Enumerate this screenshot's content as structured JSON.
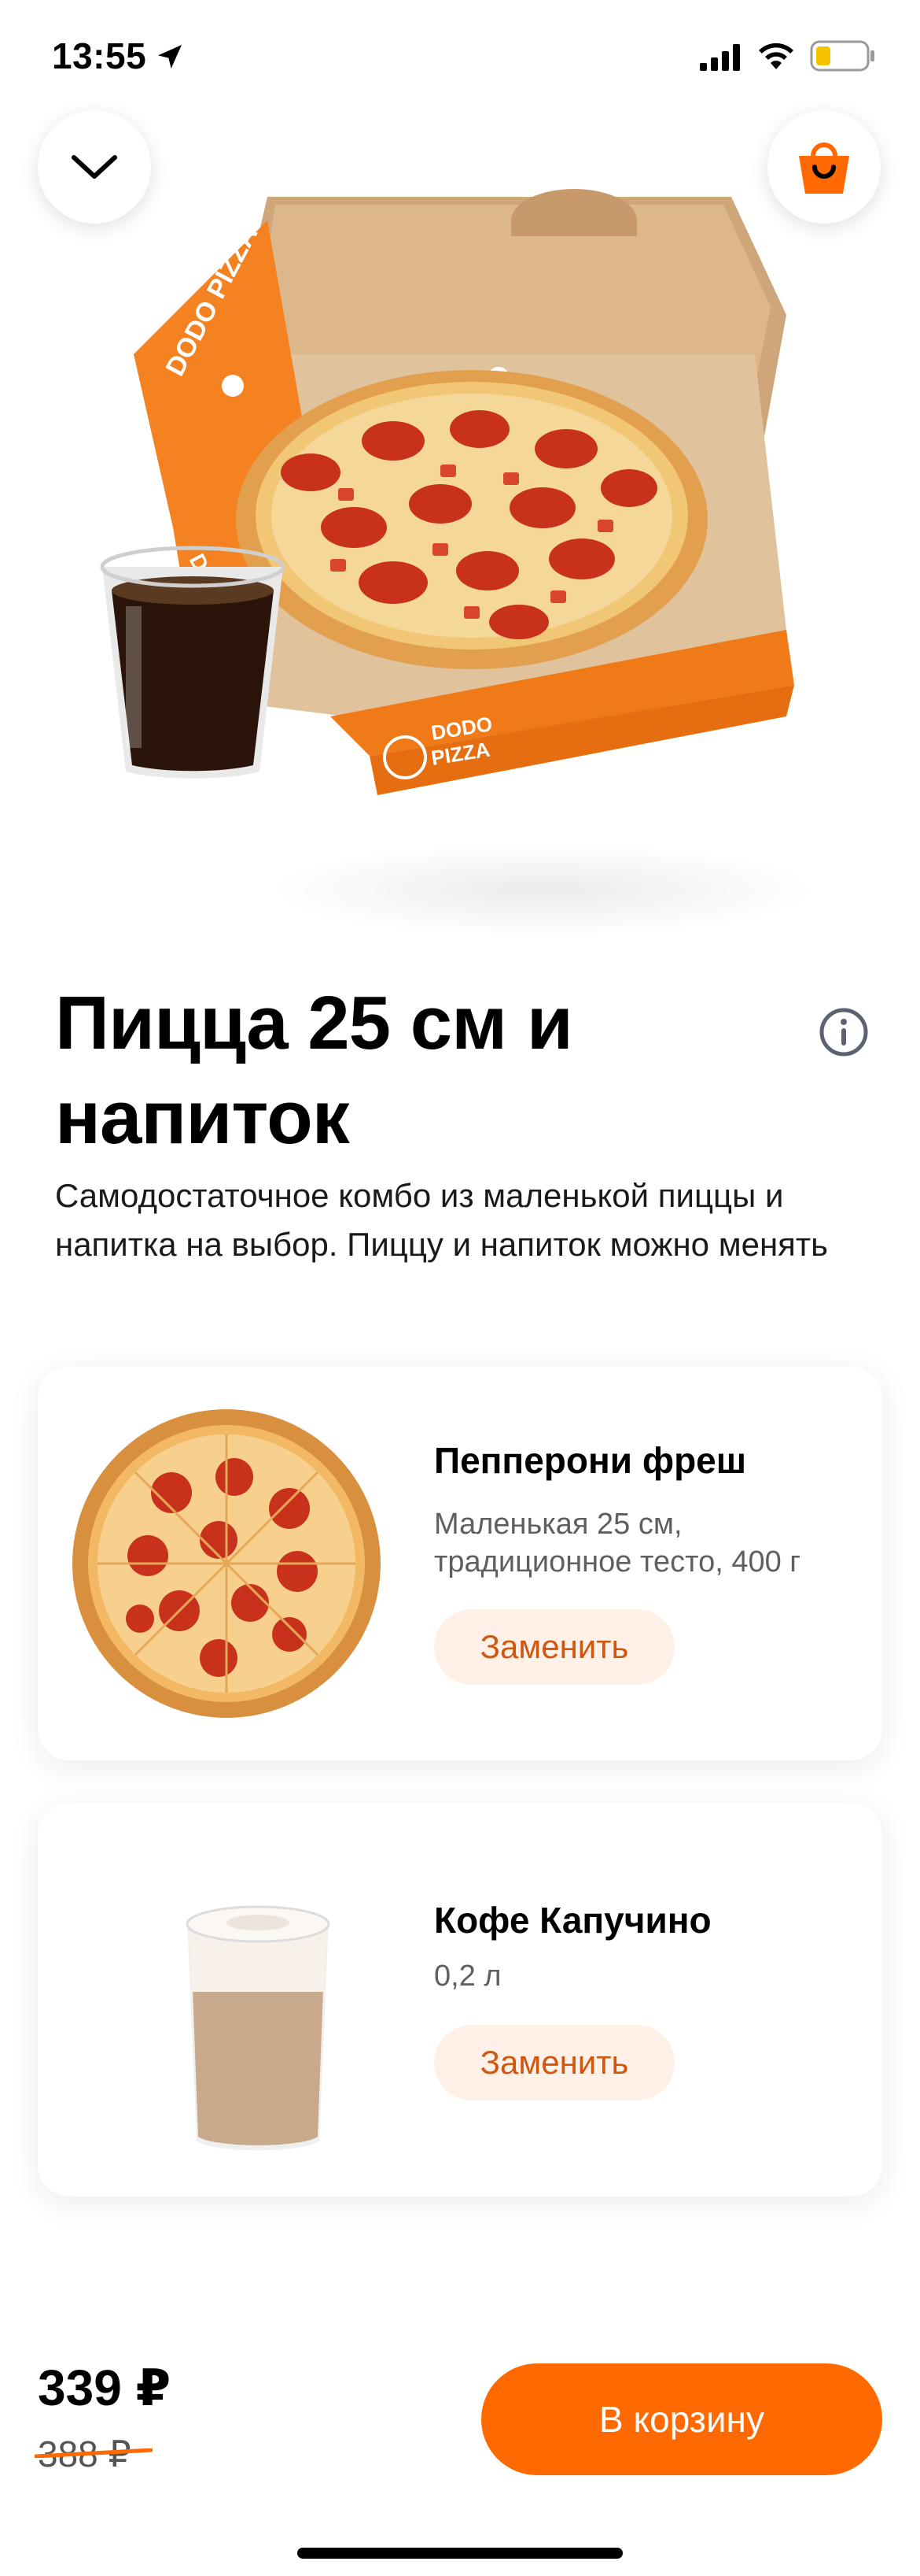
{
  "status": {
    "time": "13:55"
  },
  "product": {
    "title": "Пицца 25 см и напиток",
    "description": "Самодостаточное комбо из маленькой пиццы и напитка на выбор. Пиццу и напиток можно менять"
  },
  "items": [
    {
      "name": "Пепперони фреш",
      "details": "Маленькая 25 см, традиционное тесто, 400 г",
      "replace_label": "Заменить"
    },
    {
      "name": "Кофе Капучино",
      "details": "0,2 л",
      "replace_label": "Заменить"
    }
  ],
  "box_text": [
    "DODO PIZZA",
    "DODO",
    "PIZZA"
  ],
  "footer": {
    "price": "339 ₽",
    "old_price": "388 ₽",
    "add_label": "В корзину"
  },
  "colors": {
    "brand": "#ff6900",
    "replace_bg": "#fff1e8",
    "replace_text": "#d1560f"
  },
  "icons": [
    "location-arrow-icon",
    "cellular-signal-icon",
    "wifi-icon",
    "battery-icon",
    "chevron-down-icon",
    "shopping-bag-icon",
    "info-icon"
  ]
}
